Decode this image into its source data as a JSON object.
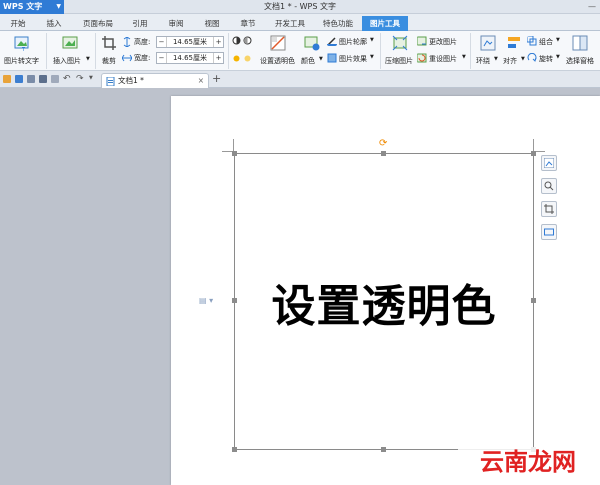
{
  "app": {
    "name": "WPS 文字",
    "window_title": "文档1 * - WPS 文字"
  },
  "menu": {
    "tabs": [
      "开始",
      "插入",
      "页面布局",
      "引用",
      "审阅",
      "视图",
      "章节",
      "开发工具",
      "特色功能",
      "图片工具"
    ]
  },
  "ribbon": {
    "pic_to_text": "图片转文字",
    "insert_pic": "插入图片",
    "crop": "裁剪",
    "height_label": "高度:",
    "height_value": "14.65厘米",
    "width_label": "宽度:",
    "width_value": "14.65厘米",
    "set_transparent": "设置透明色",
    "color": "颜色",
    "pic_outline": "图片轮廓",
    "pic_effect": "图片效果",
    "compress": "压缩图片",
    "change_pic": "更改图片",
    "reset_pic": "重设图片",
    "wrap": "环绕",
    "align": "对齐",
    "group": "组合",
    "rotate": "旋转",
    "selection_pane": "选择窗格"
  },
  "doc_tab": {
    "title": "文档1 *",
    "close": "×",
    "new": "+"
  },
  "document": {
    "image_text": "设置透明色"
  },
  "watermark": {
    "brand": "云南龙网"
  },
  "colors": {
    "accent": "#3a8ee0",
    "wps_blue": "#2f7bd5",
    "rotate_handle": "#f08a00",
    "brand_red": "#e02222"
  }
}
